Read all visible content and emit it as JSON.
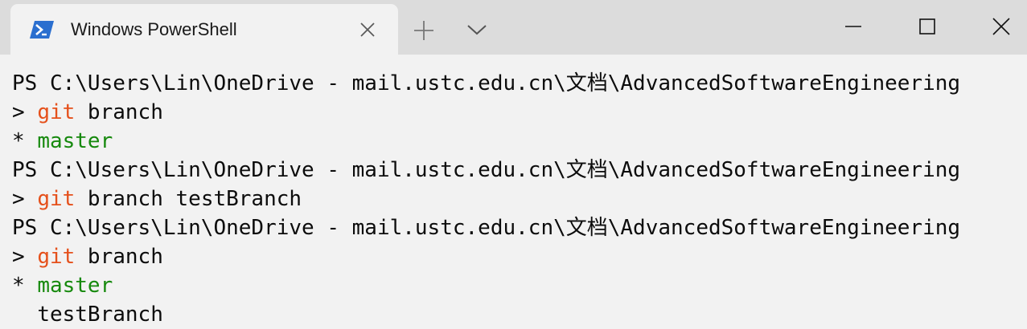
{
  "window": {
    "tab_title": "Windows PowerShell"
  },
  "icons": {
    "tab_icon": "powershell-icon",
    "tab_close": "close-icon",
    "new_tab": "plus-icon",
    "dropdown": "chevron-down-icon",
    "minimize": "minimize-icon",
    "maximize": "maximize-icon",
    "close": "close-icon"
  },
  "colors": {
    "command": "#e5501b",
    "current_branch": "#16890d",
    "text": "#0c0c0c",
    "background": "#f2f2f2",
    "titlebar": "#dcdcdc"
  },
  "terminal": {
    "prompt": "PS C:\\Users\\Lin\\OneDrive - mail.ustc.edu.cn\\文档\\AdvancedSoftwareEngineering",
    "prompt_symbol": "> ",
    "cmd_name": "git",
    "cmd1_args": " branch",
    "cmd2_args": " branch testBranch",
    "cmd3_args": " branch",
    "star": "* ",
    "master": "master",
    "indent": "  ",
    "test_branch": "testBranch"
  }
}
